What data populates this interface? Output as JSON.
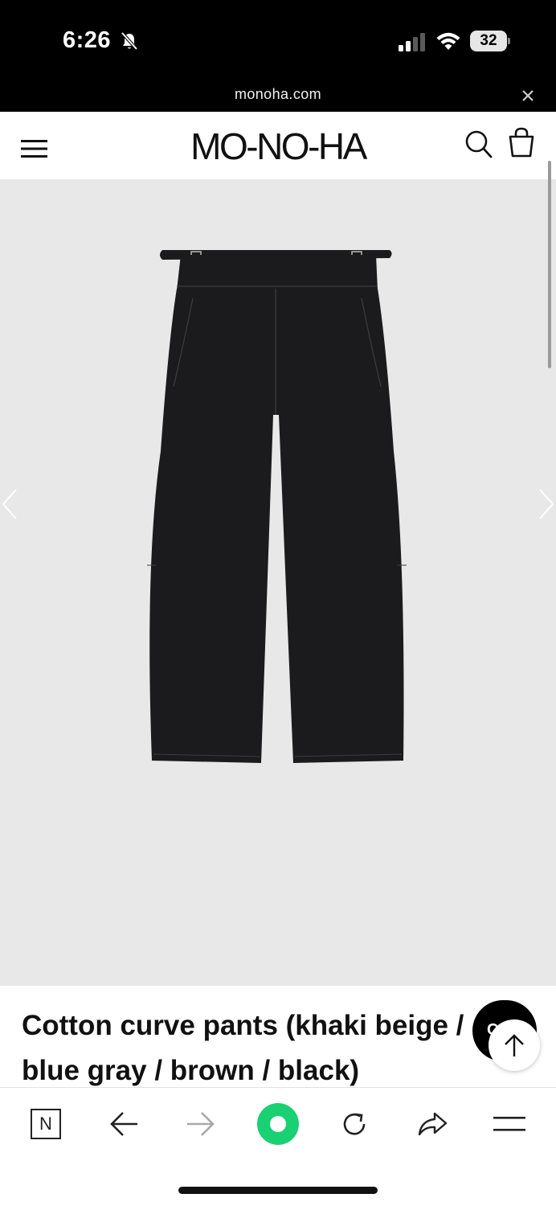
{
  "status_bar": {
    "time": "6:26",
    "battery_level": "32",
    "icons": [
      "bell-muted-icon",
      "cellular-signal-icon",
      "wifi-icon",
      "battery-icon"
    ]
  },
  "browser": {
    "url": "monoha.com"
  },
  "site_header": {
    "logo": "MO-NO-HA",
    "icons": [
      "menu-icon",
      "search-icon",
      "shopping-bag-icon"
    ]
  },
  "product": {
    "title_line1": "Cotton curve pants (khaki beige /",
    "title_line2": "blue gray / brown / black)",
    "image_color": "#1b1b1d",
    "gallery_background": "#e8e8e8"
  },
  "floating_buttons": {
    "chat_label": "CS",
    "scroll_top": "arrow-up-icon"
  },
  "bottom_toolbar": {
    "naver_label": "N",
    "items": [
      "naver-icon",
      "back-arrow-icon",
      "forward-arrow-icon",
      "green-dot-icon",
      "reload-icon",
      "share-icon",
      "menu-icon"
    ],
    "accent_color": "#19d173"
  }
}
